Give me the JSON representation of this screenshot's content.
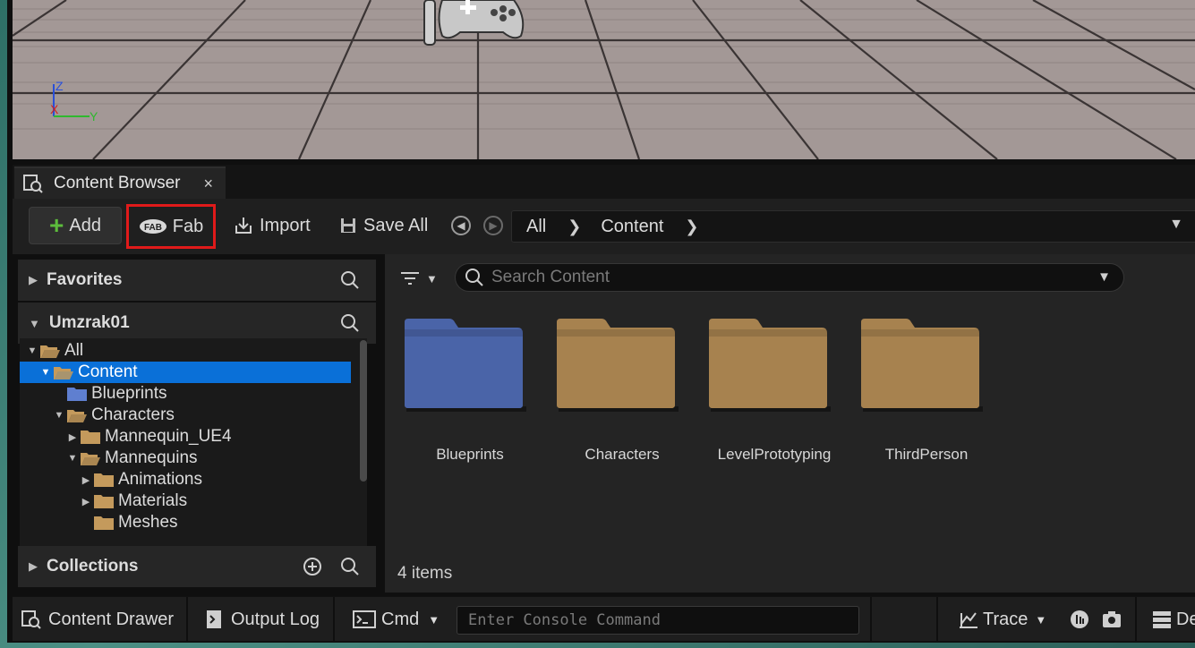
{
  "tab": {
    "title": "Content Browser",
    "close": "×"
  },
  "toolbar": {
    "add_label": "Add",
    "fab_label": "Fab",
    "import_label": "Import",
    "saveall_label": "Save All"
  },
  "path": {
    "root": "All",
    "current": "Content"
  },
  "sections": {
    "favorites": "Favorites",
    "project": "Umzrak01",
    "collections": "Collections"
  },
  "tree": [
    {
      "label": "All",
      "level": 0,
      "expanded": true
    },
    {
      "label": "Content",
      "level": 1,
      "expanded": true,
      "selected": true
    },
    {
      "label": "Blueprints",
      "level": 2,
      "expanded": false,
      "blue": true,
      "leaf": true
    },
    {
      "label": "Characters",
      "level": 2,
      "expanded": true
    },
    {
      "label": "Mannequin_UE4",
      "level": 3,
      "expanded": false
    },
    {
      "label": "Mannequins",
      "level": 3,
      "expanded": true
    },
    {
      "label": "Animations",
      "level": 4,
      "expanded": false
    },
    {
      "label": "Materials",
      "level": 4,
      "expanded": false
    },
    {
      "label": "Meshes",
      "level": 4,
      "leaf": true
    }
  ],
  "search": {
    "placeholder": "Search Content"
  },
  "folders": [
    {
      "name": "Blueprints",
      "color": "#4a64a8"
    },
    {
      "name": "Characters",
      "color": "#a7824f"
    },
    {
      "name": "LevelPrototyping",
      "color": "#a7824f"
    },
    {
      "name": "ThirdPerson",
      "color": "#a7824f"
    }
  ],
  "items_count": "4 items",
  "statusbar": {
    "content_drawer": "Content Drawer",
    "output_log": "Output Log",
    "cmd": "Cmd",
    "console_placeholder": "Enter Console Command",
    "trace": "Trace",
    "derived": "De"
  },
  "axis_labels": {
    "z": "Z",
    "x": "X",
    "y": "Y"
  },
  "colors": {
    "accent_blue": "#0a70d8",
    "highlight_red": "#e01a1a",
    "add_green": "#5cbc3c"
  }
}
